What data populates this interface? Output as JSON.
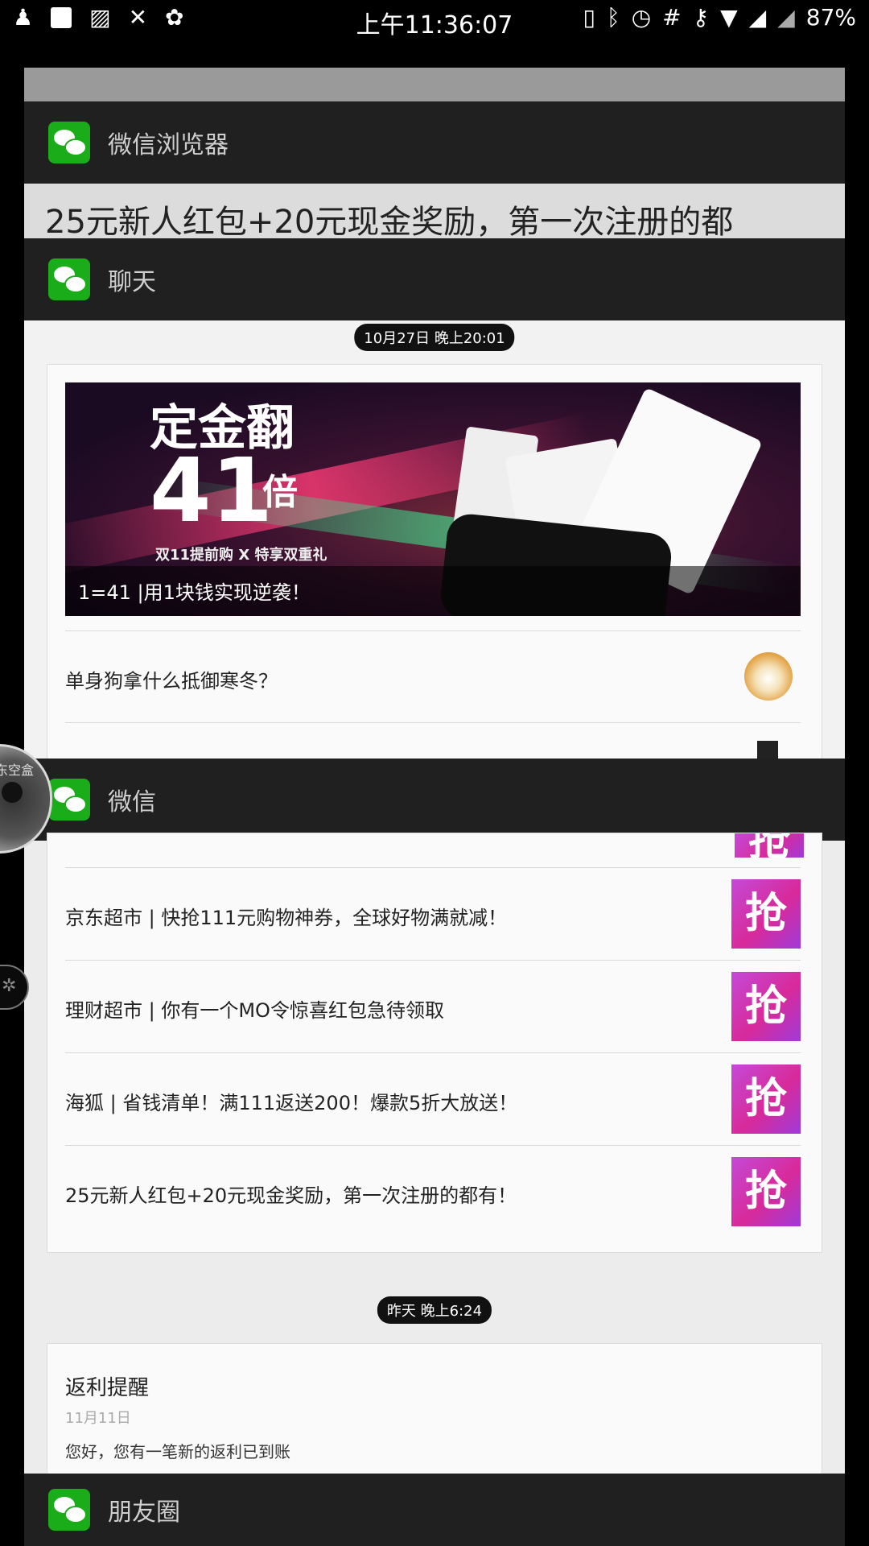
{
  "status_bar": {
    "time": "上午11:36:07",
    "battery": "87%",
    "left_icons": [
      "qq-notification-icon",
      "screenshot-icon",
      "image-icon",
      "vpn-icon",
      "maple-leaf-icon"
    ],
    "right_icons": [
      "phone-vibrate-icon",
      "bluetooth-icon",
      "alarm-icon",
      "hashtag-icon",
      "key-icon",
      "wifi-icon",
      "signal-icon",
      "signal-2-icon"
    ]
  },
  "recents": {
    "browser": {
      "title": "微信浏览器",
      "preview": "25元新人红包+20元现金奖励，第一次注册的都"
    },
    "chat": {
      "title": "聊天",
      "time_pill": "10月27日 晚上20:01",
      "banner": {
        "line1": "定金翻",
        "big_number": "41",
        "suffix": "倍",
        "tagline": "双11提前购 X 特享双重礼",
        "caption": "1=41 |用1块钱实现逆袭！"
      },
      "first_item": "单身狗拿什么抵御寒冬？"
    },
    "wechat": {
      "title": "微信",
      "items": [
        {
          "text": "京东超市 | 快抢111元购物神券，全球好物满就减！",
          "thumb": "抢"
        },
        {
          "text": "理财超市 | 你有一个MO令惊喜红包急待领取",
          "thumb": "抢"
        },
        {
          "text": "海狐 | 省钱清单！满111返送200！爆款5折大放送！",
          "thumb": "抢"
        },
        {
          "text": "25元新人红包+20元现金奖励，第一次注册的都有！",
          "thumb": "抢"
        }
      ],
      "partial_thumb": "抢",
      "time_pill2": "昨天 晚上6:24",
      "notice": {
        "title": "返利提醒",
        "date": "11月11日",
        "body": "您好，您有一笔新的返利已到账"
      }
    },
    "moments": {
      "title": "朋友圈"
    }
  },
  "bubble_label": "东空盒"
}
